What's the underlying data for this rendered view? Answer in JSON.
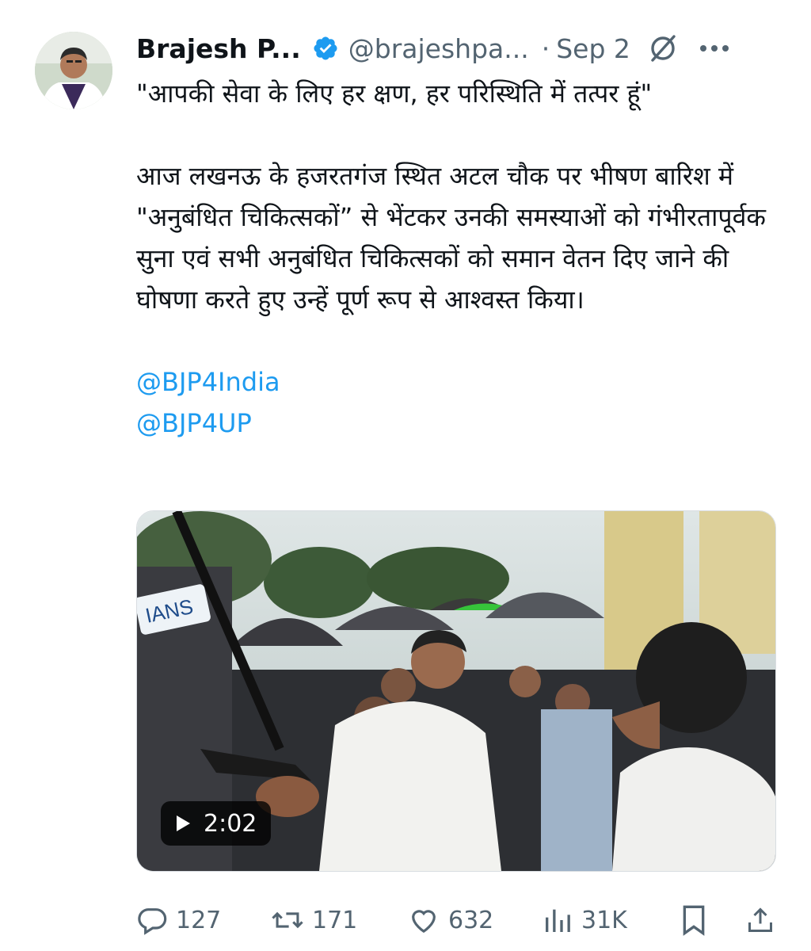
{
  "tweet": {
    "display_name": "Brajesh P...",
    "handle": "@brajeshpa...",
    "separator": "·",
    "date": "Sep 2",
    "text_line1": "\"आपकी सेवा के लिए हर क्षण, हर परिस्थिति में तत्पर हूं\"",
    "text_paragraph2": "आज लखनऊ के हजरतगंज स्थित अटल चौक पर भीषण बारिश में \"अनुबंधित चिकित्सकों” से भेंटकर उनकी समस्याओं को गंभीरतापूर्वक सुना एवं सभी अनुबंधित चिकित्सकों को समान वेतन दिए जाने की घोषणा करते हुए उन्हें पूर्ण रूप से आश्वस्त किया।",
    "mentions": [
      "@BJP4India",
      "@BJP4UP"
    ]
  },
  "media": {
    "type": "video",
    "duration": "2:02",
    "mic_label": "IANS"
  },
  "actions": {
    "replies": "127",
    "reposts": "171",
    "likes": "632",
    "views": "31K"
  },
  "icons": {
    "verified": "verified-badge-icon",
    "grok": "grok-icon",
    "more": "more-icon",
    "reply": "reply-icon",
    "repost": "repost-icon",
    "like": "heart-icon",
    "views": "views-icon",
    "bookmark": "bookmark-icon",
    "share": "share-icon",
    "play": "play-icon"
  },
  "colors": {
    "text": "#0f1419",
    "secondary": "#536471",
    "accent": "#1d9bf0"
  }
}
